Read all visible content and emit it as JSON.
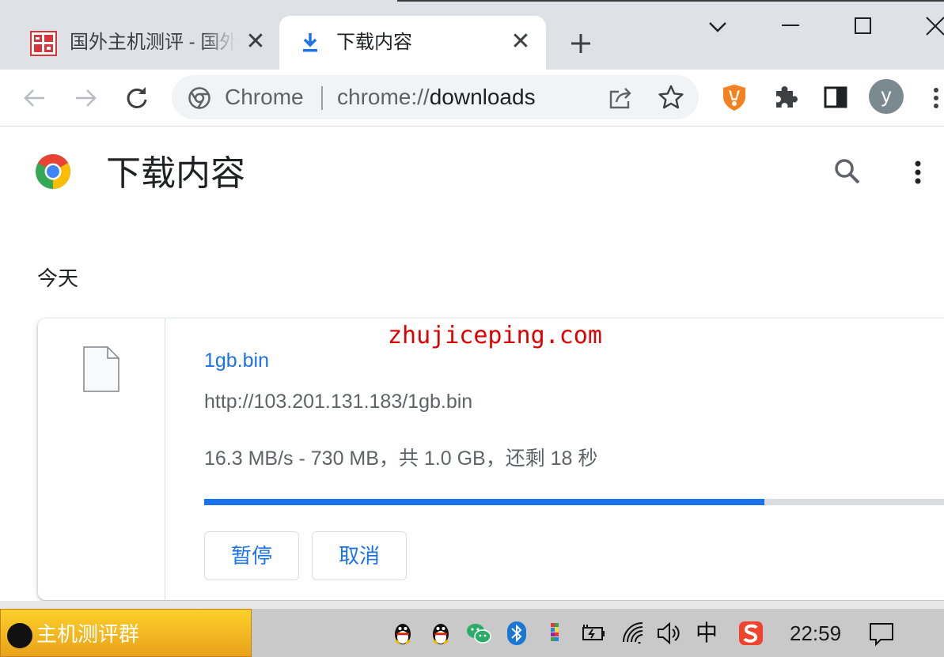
{
  "tabs": [
    {
      "title": "国外主机测评 - 国外",
      "close_glyph": "✕",
      "favicon": "site-logo-icon",
      "active": false
    },
    {
      "title": "下载内容",
      "close_glyph": "✕",
      "favicon": "download-icon",
      "active": true
    }
  ],
  "omnibox": {
    "site_label": "Chrome",
    "url_scheme": "chrome://",
    "url_path": "downloads"
  },
  "profile": {
    "initial": "y"
  },
  "page": {
    "title": "下载内容",
    "date_header": "今天"
  },
  "download": {
    "file_name": "1gb.bin",
    "url": "http://103.201.131.183/1gb.bin",
    "status": "16.3 MB/s - 730 MB，共 1.0 GB，还剩 18 秒",
    "progress_fraction": 0.745,
    "pause_label": "暂停",
    "cancel_label": "取消"
  },
  "watermark": "zhujiceping.com",
  "taskbar": {
    "group_label": "主机测评群",
    "ime_label": "中",
    "clock": "22:59"
  },
  "colors": {
    "accent": "#1a73e8",
    "tabstrip": "#dee1e6",
    "watermark": "#e00000",
    "taskbar_group": "#f2b71f"
  }
}
